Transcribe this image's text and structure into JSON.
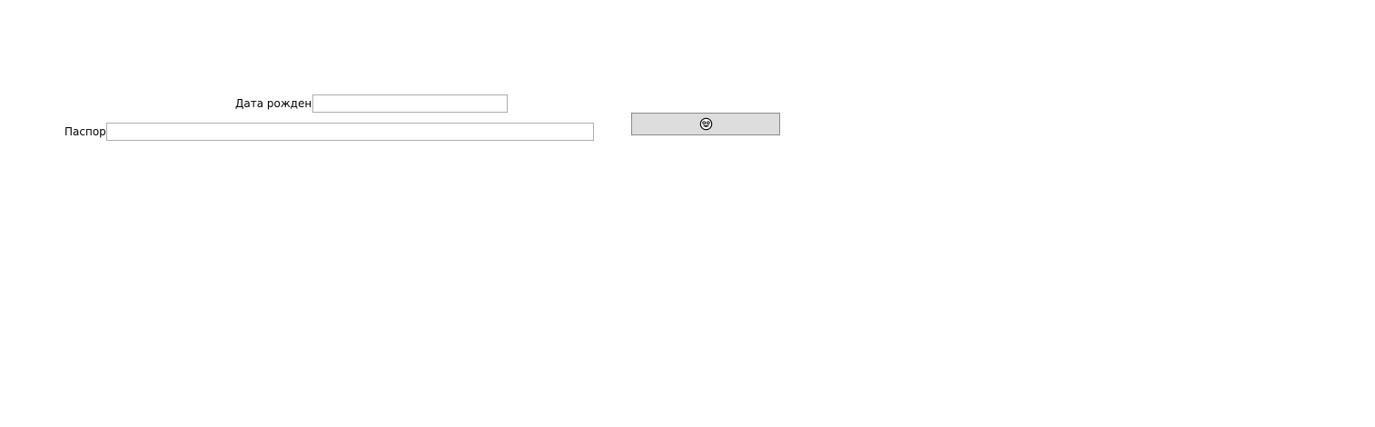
{
  "form": {
    "birthdate": {
      "label": "Дата рождения",
      "value": "",
      "placeholder": ""
    },
    "passport": {
      "label": "Паспорт",
      "value": "",
      "placeholder": ""
    },
    "action_button": {
      "icon": "smiley-face-icon"
    }
  },
  "colors": {
    "background": "#ffffff",
    "field_border": "#acacac",
    "button_background": "#dddddd",
    "button_border": "#8a8a8a"
  }
}
